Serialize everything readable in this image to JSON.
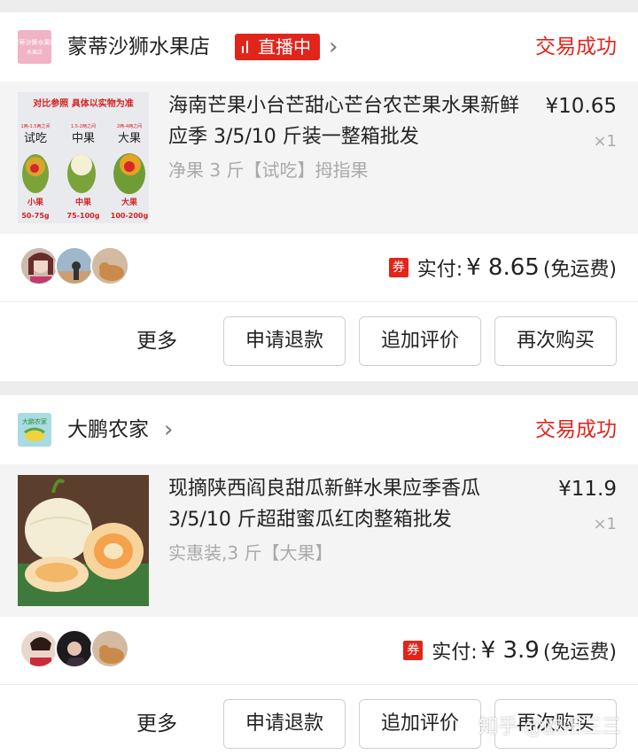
{
  "orders": [
    {
      "shop_name": "蒙蒂沙狮水果店",
      "shop_logo_text": "蒙蒂沙狮水果店",
      "live_badge": "直播中",
      "status": "交易成功",
      "item": {
        "title": "海南芒果小台芒甜心芒台农芒果水果新鲜应季 3/5/10 斤装一整箱批发",
        "spec": "净果 3 斤【试吃】拇指果",
        "price": "¥10.65",
        "qty": "×1",
        "image": {
          "header": "对比参照  具体以实物为准",
          "weights": [
            "1两-1.5两之间",
            "1.5-2两之间",
            "2两-4两之间"
          ],
          "big_labels": [
            "试吃",
            "中果",
            "大果"
          ],
          "sizes": [
            "小果",
            "中果",
            "大果"
          ],
          "grams": [
            "50-75g",
            "75-100g",
            "100-200g"
          ]
        }
      },
      "payment": {
        "label": "实付:",
        "amount": "¥ 8.65",
        "note": "(免运费)",
        "coupon": "券"
      },
      "actions": {
        "more": "更多",
        "refund": "申请退款",
        "review": "追加评价",
        "rebuy": "再次购买"
      }
    },
    {
      "shop_name": "大鹏农家",
      "shop_logo_text": "大鹏农家",
      "status": "交易成功",
      "item": {
        "title": "现摘陕西阎良甜瓜新鲜水果应季香瓜 3/5/10 斤超甜蜜瓜红肉整箱批发",
        "spec": "实惠装,3 斤【大果】",
        "price": "¥11.9",
        "qty": "×1"
      },
      "payment": {
        "label": "实付:",
        "amount": "¥ 3.9",
        "note": "(免运费)",
        "coupon": "券"
      },
      "actions": {
        "more": "更多",
        "refund": "申请退款",
        "review": "追加评价",
        "rebuy": "再次购买"
      }
    }
  ],
  "watermark": "知乎 @欧阳三三",
  "colors": {
    "accent": "#e1251b",
    "background": "#ededed",
    "item_bg": "#f4f4f4"
  }
}
